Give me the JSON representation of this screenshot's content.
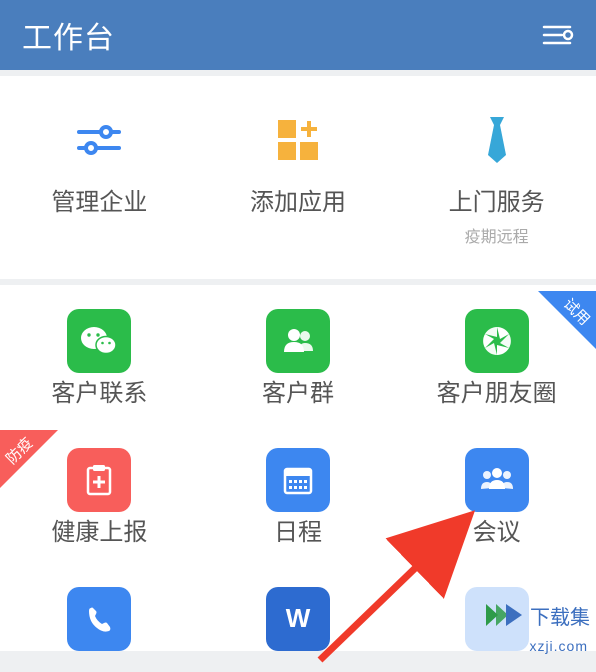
{
  "header": {
    "title": "工作台"
  },
  "topRow": {
    "items": [
      {
        "label": "管理企业"
      },
      {
        "label": "添加应用"
      },
      {
        "label": "上门服务",
        "sublabel": "疫期远程"
      }
    ]
  },
  "apps": {
    "row1": [
      {
        "label": "客户联系"
      },
      {
        "label": "客户群"
      },
      {
        "label": "客户朋友圈",
        "ribbon": "试用"
      }
    ],
    "row2": [
      {
        "label": "健康上报",
        "ribbon": "防疫"
      },
      {
        "label": "日程"
      },
      {
        "label": "会议"
      }
    ]
  },
  "watermark": {
    "text": "下载集",
    "sub": "xzji.com"
  },
  "colors": {
    "headerBg": "#4a7ebd",
    "iconGreen": "#2bbc4a",
    "iconBlue": "#3d87f0",
    "iconRed": "#f85e5b",
    "arrow": "#f03a2a"
  }
}
